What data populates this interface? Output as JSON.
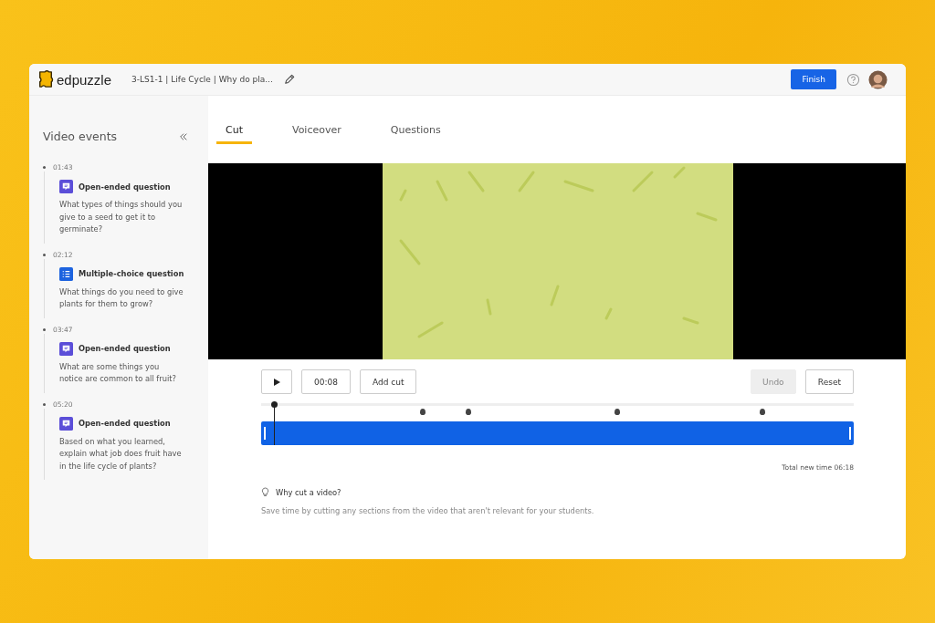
{
  "header": {
    "logo": "edpuzzle",
    "video_title": "3-LS1-1 | Life Cycle | Why do pla...",
    "finish_button": "Finish"
  },
  "sidebar": {
    "title": "Video events",
    "events": [
      {
        "time": "01:43",
        "kind": "open",
        "type_label": "Open-ended question",
        "question": "What types of things should you give to a seed to get it to germinate?"
      },
      {
        "time": "02:12",
        "kind": "choice",
        "type_label": "Multiple-choice question",
        "question": "What things do you need to give plants for them to grow?"
      },
      {
        "time": "03:47",
        "kind": "open",
        "type_label": "Open-ended question",
        "question": "What are some things you notice are common to all fruit?"
      },
      {
        "time": "05:20",
        "kind": "open",
        "type_label": "Open-ended question",
        "question": "Based on what you learned, explain what job does fruit have in the life cycle of plants?"
      }
    ]
  },
  "tabs": [
    {
      "label": "Cut",
      "selected": true
    },
    {
      "label": "Voiceover",
      "selected": false
    },
    {
      "label": "Questions",
      "selected": false
    }
  ],
  "controls": {
    "current_time": "00:08",
    "add_cut": "Add cut",
    "undo": {
      "label": "Undo",
      "disabled": true
    },
    "reset": {
      "label": "Reset",
      "disabled": false
    }
  },
  "total_time": "Total new time 06:18",
  "tip": {
    "title": "Why cut a video?",
    "text": "Save time by cutting any sections from the video that aren't relevant for your students."
  }
}
